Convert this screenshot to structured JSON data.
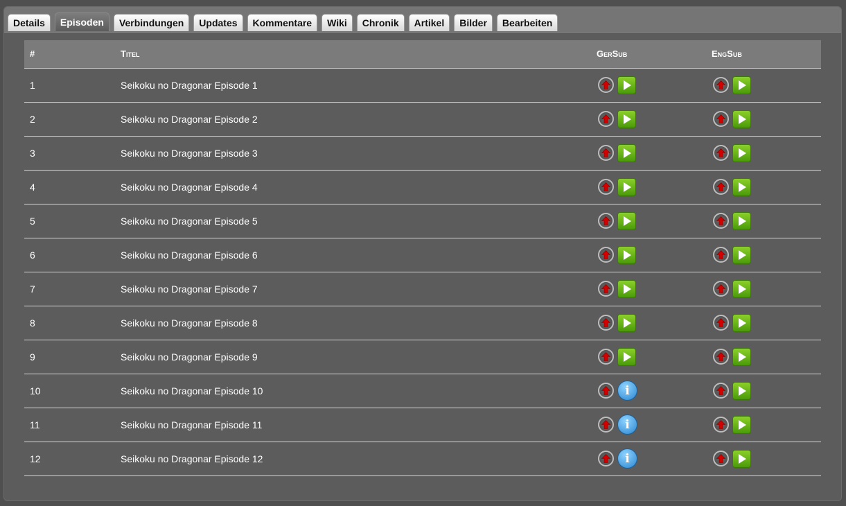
{
  "tabs": [
    {
      "label": "Details",
      "active": false
    },
    {
      "label": "Episoden",
      "active": true
    },
    {
      "label": "Verbindungen",
      "active": false
    },
    {
      "label": "Updates",
      "active": false
    },
    {
      "label": "Kommentare",
      "active": false
    },
    {
      "label": "Wiki",
      "active": false
    },
    {
      "label": "Chronik",
      "active": false
    },
    {
      "label": "Artikel",
      "active": false
    },
    {
      "label": "Bilder",
      "active": false
    },
    {
      "label": "Bearbeiten",
      "active": false
    }
  ],
  "table": {
    "headers": {
      "num": "#",
      "title": "Titel",
      "gersub": "GerSub",
      "engsub": "EngSub"
    },
    "rows": [
      {
        "num": "1",
        "title": "Seikoku no Dragonar Episode 1",
        "gersub": "play",
        "engsub": "play"
      },
      {
        "num": "2",
        "title": "Seikoku no Dragonar Episode 2",
        "gersub": "play",
        "engsub": "play"
      },
      {
        "num": "3",
        "title": "Seikoku no Dragonar Episode 3",
        "gersub": "play",
        "engsub": "play"
      },
      {
        "num": "4",
        "title": "Seikoku no Dragonar Episode 4",
        "gersub": "play",
        "engsub": "play"
      },
      {
        "num": "5",
        "title": "Seikoku no Dragonar Episode 5",
        "gersub": "play",
        "engsub": "play"
      },
      {
        "num": "6",
        "title": "Seikoku no Dragonar Episode 6",
        "gersub": "play",
        "engsub": "play"
      },
      {
        "num": "7",
        "title": "Seikoku no Dragonar Episode 7",
        "gersub": "play",
        "engsub": "play"
      },
      {
        "num": "8",
        "title": "Seikoku no Dragonar Episode 8",
        "gersub": "play",
        "engsub": "play"
      },
      {
        "num": "9",
        "title": "Seikoku no Dragonar Episode 9",
        "gersub": "play",
        "engsub": "play"
      },
      {
        "num": "10",
        "title": "Seikoku no Dragonar Episode 10",
        "gersub": "info",
        "engsub": "play"
      },
      {
        "num": "11",
        "title": "Seikoku no Dragonar Episode 11",
        "gersub": "info",
        "engsub": "play"
      },
      {
        "num": "12",
        "title": "Seikoku no Dragonar Episode 12",
        "gersub": "info",
        "engsub": "play"
      }
    ]
  },
  "icons": {
    "upload": "red-up-arrow-icon",
    "play": "green-play-icon",
    "info": "blue-info-icon",
    "info_glyph": "i"
  },
  "colors": {
    "background": "#5c5c5c",
    "header": "#7b7b7b",
    "play_green": "#6cb81a",
    "info_blue": "#2a86d0",
    "arrow_red": "#d40000"
  }
}
